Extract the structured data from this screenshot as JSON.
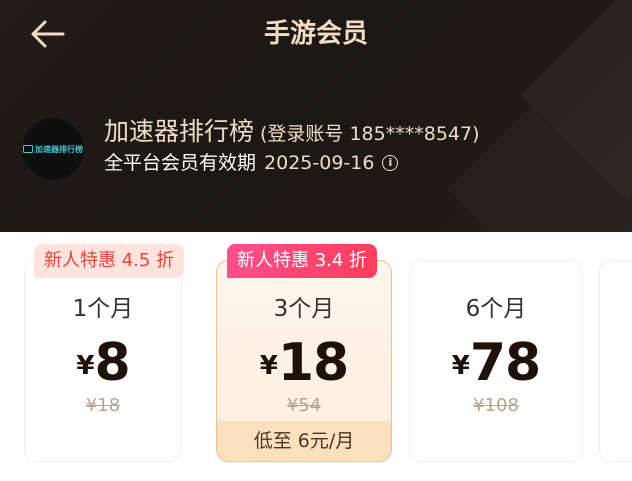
{
  "header": {
    "title": "手游会员",
    "back_icon": "back-arrow-icon"
  },
  "user": {
    "avatar_logo_text": "加速器排行榜",
    "name": "加速器排行榜",
    "login_info": "(登录账号 185****8547)",
    "expiry_label": "全平台会员有效期",
    "expiry_date": "2025-09-16",
    "info_icon": "info-icon"
  },
  "plans": [
    {
      "badge": "新人特惠 4.5 折",
      "period": "1个月",
      "currency": "¥",
      "price": "8",
      "original": "¥18",
      "selected": false
    },
    {
      "badge": "新人特惠 3.4 折",
      "period": "3个月",
      "currency": "¥",
      "price": "18",
      "original": "¥54",
      "monthly": "低至 6元/月",
      "selected": true
    },
    {
      "period": "6个月",
      "currency": "¥",
      "price": "78",
      "original": "¥108",
      "selected": false
    }
  ],
  "colors": {
    "header_bg": "#1b1714",
    "title_gold": "#f2dcc3",
    "badge_hot": "#ff4f8c",
    "badge_soft_bg": "#ffe3de",
    "badge_soft_text": "#e64438",
    "selected_border": "#efc089"
  }
}
